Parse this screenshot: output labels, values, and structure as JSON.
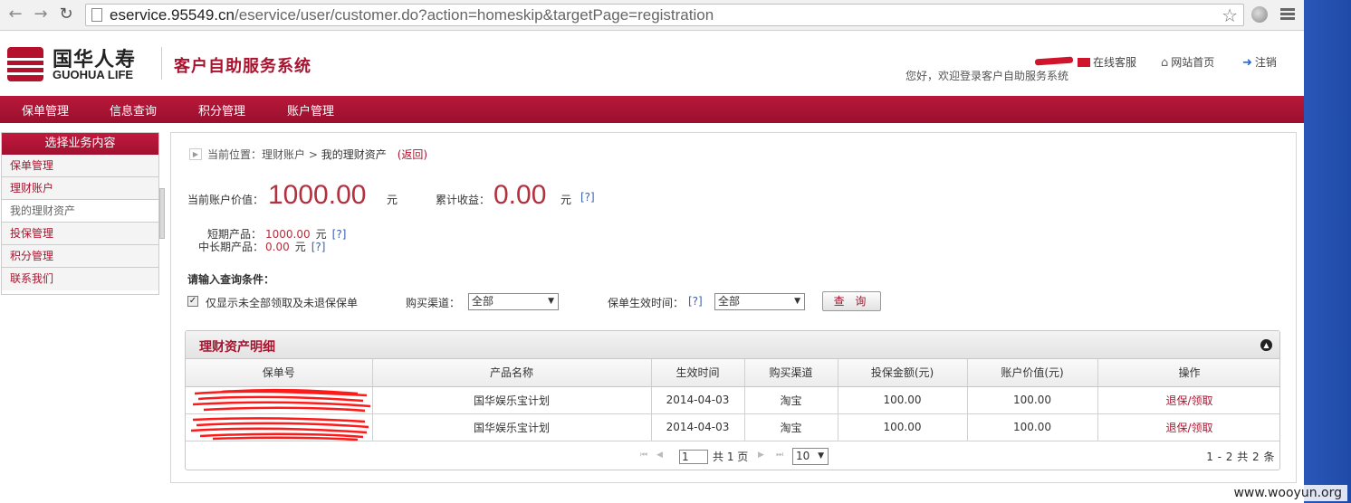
{
  "browser": {
    "url_host": "eservice.95549.cn",
    "url_path": "/eservice/user/customer.do?action=homeskip&targetPage=registration"
  },
  "header": {
    "logo_cn": "国华人寿",
    "logo_en": "GUOHUA LIFE",
    "system_title": "客户自助服务系统",
    "online_service": "在线客服",
    "home_link": "网站首页",
    "logout": "注销",
    "welcome": "您好，欢迎登录客户自助服务系统"
  },
  "main_nav": [
    "保单管理",
    "信息查询",
    "积分管理",
    "账户管理"
  ],
  "sidebar": {
    "title": "选择业务内容",
    "items": [
      "保单管理",
      "理财账户",
      "我的理财资产",
      "投保管理",
      "积分管理",
      "联系我们"
    ]
  },
  "breadcrumb": {
    "prefix": "当前位置：理财账户 > ",
    "current": "我的理财资产",
    "back": "(返回)"
  },
  "summary": {
    "account_label": "当前账户价值：",
    "account_value": "1000.00",
    "account_unit": "元",
    "earnings_label": "累计收益：",
    "earnings_value": "0.00",
    "earnings_unit": "元",
    "help": "[?]",
    "short_label": "短期产品：",
    "short_value": "1000.00",
    "long_label": "中长期产品：",
    "long_value": "0.00"
  },
  "query": {
    "title": "请输入查询条件：",
    "checkbox_label": "仅显示未全部领取及未退保保单",
    "channel_label": "购买渠道：",
    "channel_value": "全部",
    "date_label": "保单生效时间：",
    "date_help": "[?]",
    "date_value": "全部",
    "button": "查 询"
  },
  "grid": {
    "title": "理财资产明细",
    "columns": [
      "保单号",
      "产品名称",
      "生效时间",
      "购买渠道",
      "投保金额(元)",
      "账户价值(元)",
      "操作"
    ],
    "rows": [
      {
        "product": "国华娱乐宝计划",
        "date": "2014-04-03",
        "channel": "淘宝",
        "amount": "100.00",
        "value": "100.00",
        "action": "退保/领取"
      },
      {
        "product": "国华娱乐宝计划",
        "date": "2014-04-03",
        "channel": "淘宝",
        "amount": "100.00",
        "value": "100.00",
        "action": "退保/领取"
      }
    ],
    "pager": {
      "page_input": "1",
      "total_pages": "共 1 页",
      "page_size": "10",
      "range": "1 - 2  共 2 条"
    }
  },
  "watermark": "www.wooyun.org",
  "colors": {
    "brand_red": "#a8142f",
    "value_red": "#b3303f",
    "link_blue": "#3a5fb0"
  }
}
